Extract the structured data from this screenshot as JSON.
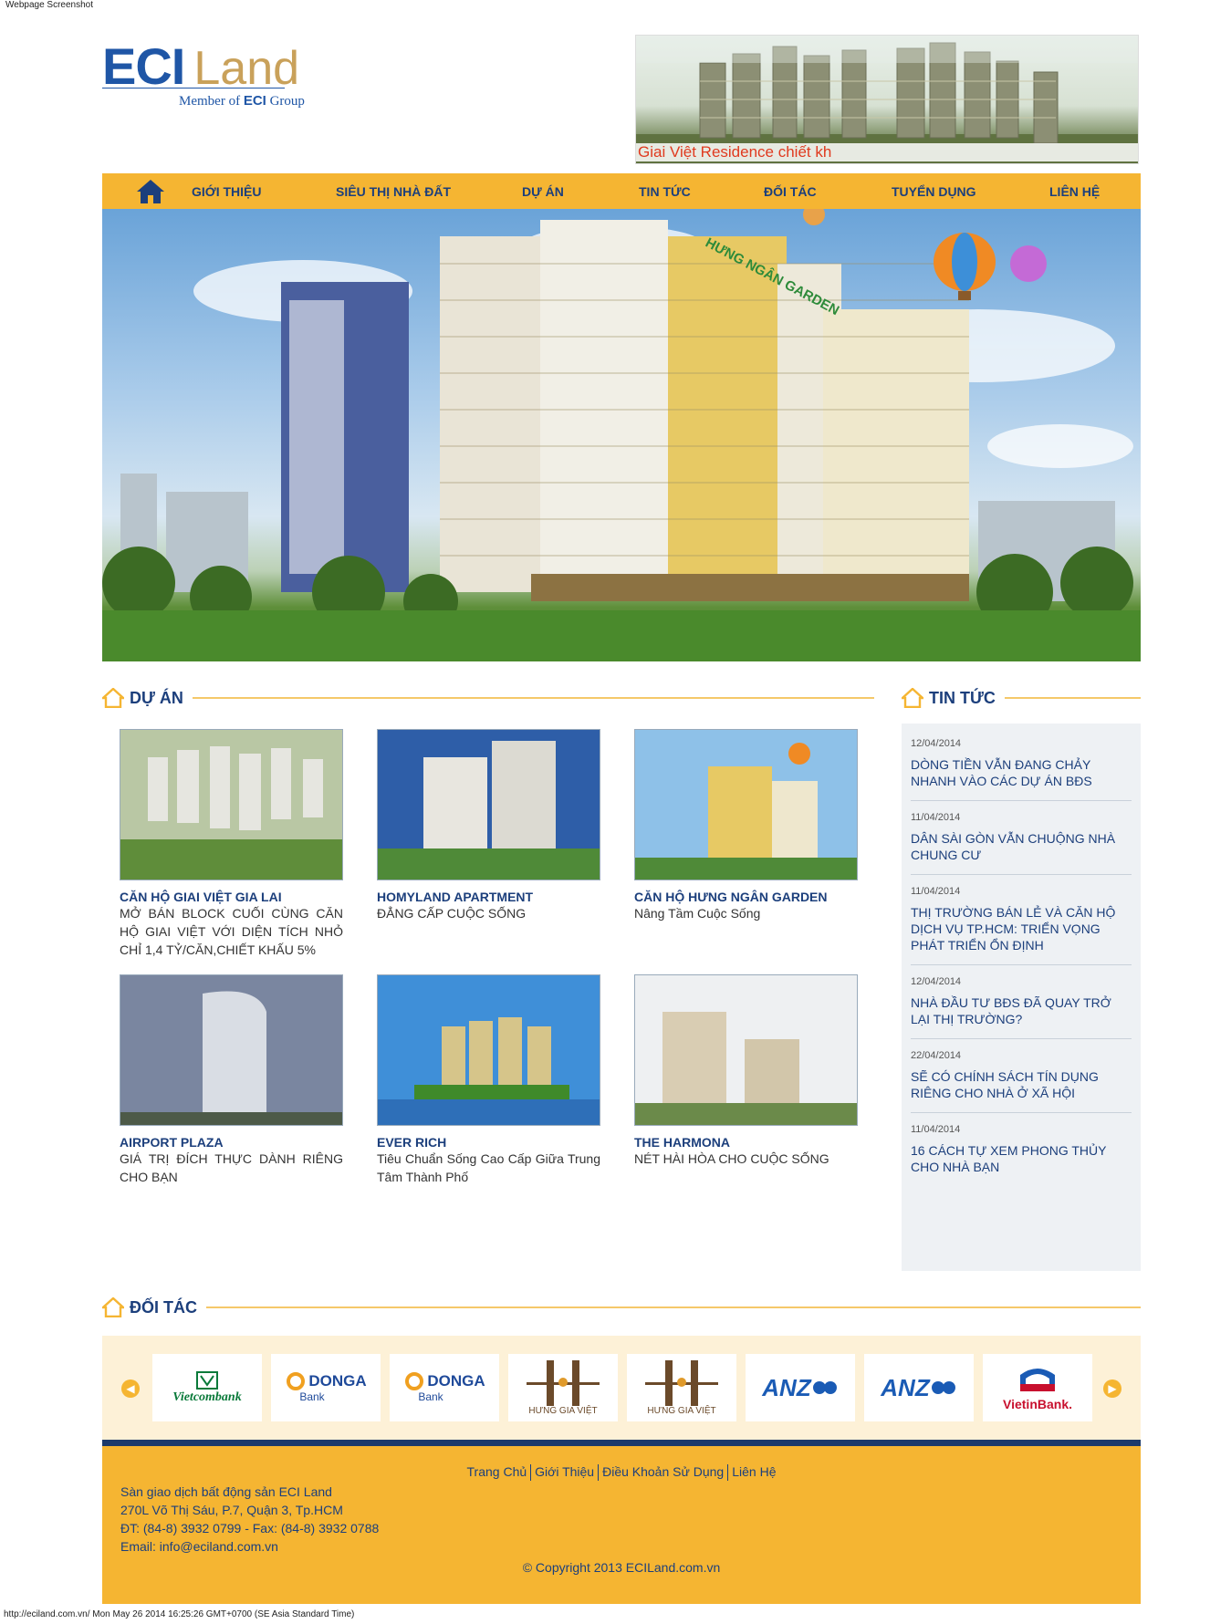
{
  "screenshot_label": "Webpage Screenshot",
  "header": {
    "logo_eci": "ECI",
    "logo_land": "Land",
    "logo_member": "Member of",
    "logo_group_eci": "ECI",
    "logo_group": "Group",
    "banner_caption": "Giai Việt Residence chiết kh"
  },
  "nav": {
    "items": [
      "GIỚI THIỆU",
      "SIÊU THỊ NHÀ ĐẤT",
      "DỰ ÁN",
      "TIN TỨC",
      "ĐỐI TÁC",
      "TUYỂN DỤNG",
      "LIÊN HỆ"
    ]
  },
  "hero": {
    "sign": "HƯNG NGÂN GARDEN"
  },
  "projects_section": {
    "title": "DỰ ÁN",
    "items": [
      {
        "name": "CĂN HỘ GIAI VIỆT GIA LAI",
        "desc": "MỞ BÁN BLOCK CUỐI CÙNG CĂN HỘ GIAI VIỆT VỚI DIỆN TÍCH NHỎ CHỈ 1,4 TỶ/CĂN,CHIẾT KHẤU 5%"
      },
      {
        "name": "HOMYLAND APARTMENT",
        "desc": "ĐẲNG CẤP CUỘC SỐNG"
      },
      {
        "name": "CĂN HỘ HƯNG NGÂN GARDEN",
        "desc": "Nâng Tầm Cuộc Sống"
      },
      {
        "name": "AIRPORT PLAZA",
        "desc": "GIÁ TRỊ ĐÍCH THỰC DÀNH RIÊNG CHO BẠN"
      },
      {
        "name": "EVER RICH",
        "desc": "Tiêu Chuẩn Sống Cao Cấp Giữa Trung Tâm Thành Phố"
      },
      {
        "name": "THE HARMONA",
        "desc": "NÉT HÀI HÒA CHO CUỘC SỐNG"
      }
    ]
  },
  "news_section": {
    "title": "TIN TỨC",
    "items": [
      {
        "date": "12/04/2014",
        "title": "DÒNG TIỀN VẪN ĐANG CHẢY NHANH VÀO CÁC DỰ ÁN BĐS"
      },
      {
        "date": "11/04/2014",
        "title": "DÂN SÀI GÒN VẪN CHUỘNG NHÀ CHUNG CƯ"
      },
      {
        "date": "11/04/2014",
        "title": "THỊ TRƯỜNG BÁN LẺ VÀ CĂN HỘ DỊCH VỤ TP.HCM: TRIỂN VỌNG PHÁT TRIỂN ỔN ĐỊNH"
      },
      {
        "date": "12/04/2014",
        "title": "NHÀ ĐẦU TƯ BĐS ĐÃ QUAY TRỞ LẠI THỊ TRƯỜNG?"
      },
      {
        "date": "22/04/2014",
        "title": "SẼ CÓ CHÍNH SÁCH TÍN DỤNG RIÊNG CHO NHÀ Ở XÃ HỘI"
      },
      {
        "date": "11/04/2014",
        "title": "16 CÁCH TỰ XEM PHONG THỦY CHO NHÀ BẠN"
      }
    ]
  },
  "partners_section": {
    "title": "ĐỐI TÁC",
    "logos": [
      {
        "text": "Vietcombank",
        "color": "#0a7a3a"
      },
      {
        "text": "DONGA",
        "sub": "Bank",
        "color": "#1f4a9a"
      },
      {
        "text": "DONGA",
        "sub": "Bank",
        "color": "#1f4a9a"
      },
      {
        "text": "HƯNG GIA VIỆT",
        "color": "#6b4a2a"
      },
      {
        "text": "HƯNG GIA VIỆT",
        "color": "#6b4a2a"
      },
      {
        "text": "ANZ",
        "color": "#1a5bb5"
      },
      {
        "text": "ANZ",
        "color": "#1a5bb5"
      },
      {
        "text": "VietinBank.",
        "color": "#c8102e"
      }
    ]
  },
  "footer": {
    "links": [
      "Trang Chủ",
      "Giới Thiệu",
      "Điều Khoản Sử Dụng",
      "Liên Hệ"
    ],
    "address_lines": [
      "Sàn giao dịch bất động sản ECI Land",
      "270L Võ Thị Sáu, P.7, Quận 3, Tp.HCM",
      "ĐT: (84-8) 3932 0799 - Fax: (84-8) 3932 0788",
      "Email: info@eciland.com.vn"
    ],
    "copyright": "© Copyright 2013 ECILand.com.vn"
  },
  "status_line": "http://eciland.com.vn/ Mon May 26 2014 16:25:26 GMT+0700 (SE Asia Standard Time)",
  "colors": {
    "nav": "#f5b532",
    "brand_blue": "#1c3f7c",
    "footer_bar": "#1c3a6b"
  }
}
